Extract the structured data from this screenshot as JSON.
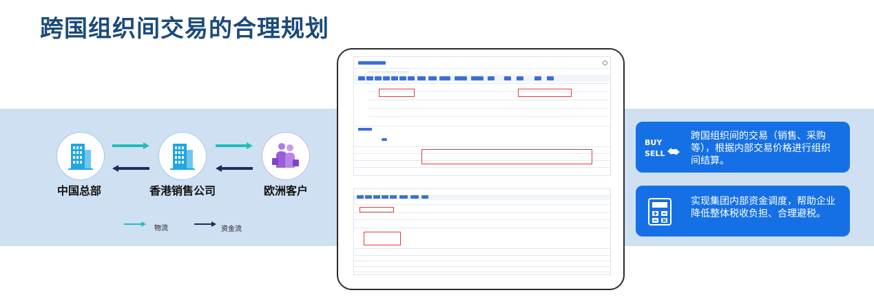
{
  "title": "跨国组织间交易的合理规划",
  "nodes": [
    {
      "name": "china-hq",
      "label": "中国总部",
      "icon": "building-icon"
    },
    {
      "name": "hk-sales",
      "label": "香港销售公司",
      "icon": "building-icon"
    },
    {
      "name": "eu-customer",
      "label": "欧洲客户",
      "icon": "business-people-icon"
    }
  ],
  "legend": {
    "goods_flow": "物流",
    "cash_flow": "资金流"
  },
  "colors": {
    "goods_flow": "#1fbfb8",
    "cash_flow": "#24285c",
    "card": "#1570e6",
    "title": "#1a4a7a",
    "band": "#cfe0f3"
  },
  "cards": [
    {
      "icon": "buy-sell-icon",
      "icon_line1": "BUY",
      "icon_line2": "SELL",
      "text": "跨国组织间的交易（销售、采购等），根据内部交易价格进行组织间结算。"
    },
    {
      "icon": "calculator-icon",
      "text": "实现集团内部资金调度，帮助企业降低整体税收负担、合理避税。"
    }
  ]
}
